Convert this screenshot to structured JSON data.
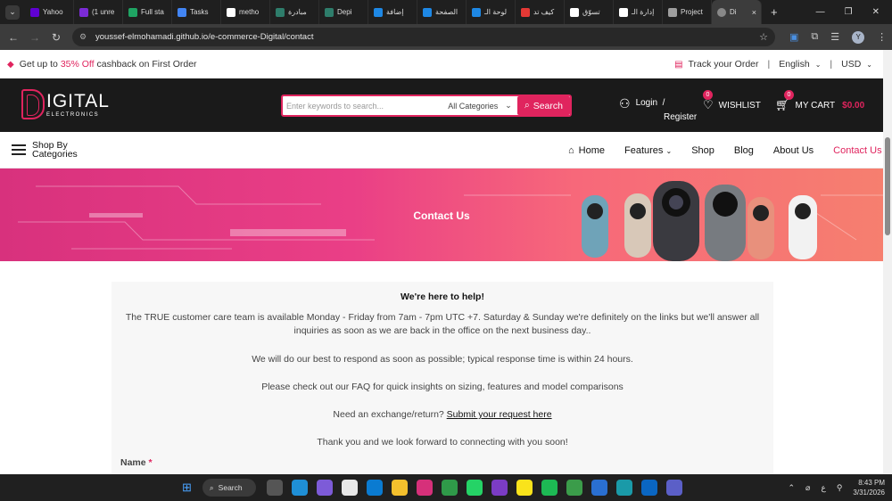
{
  "browser": {
    "tabs": [
      {
        "label": "Yahoo",
        "color": "#6001d2"
      },
      {
        "label": "(1 unre",
        "color": "#7b2bd6"
      },
      {
        "label": "Full sta",
        "color": "#1fa463"
      },
      {
        "label": "Tasks",
        "color": "#4285f4"
      },
      {
        "label": "metho",
        "color": "#ffffff"
      },
      {
        "label": "مبادرة",
        "color": "#2e7d6b"
      },
      {
        "label": "Depi",
        "color": "#2e7d6b"
      },
      {
        "label": "إضافة",
        "color": "#1e88e5"
      },
      {
        "label": "الصفحة",
        "color": "#1e88e5"
      },
      {
        "label": "لوحة الـ",
        "color": "#1e88e5"
      },
      {
        "label": "كيف تد",
        "color": "#e53935"
      },
      {
        "label": "تسوّق",
        "color": "#ffffff"
      },
      {
        "label": "إدارة الـ",
        "color": "#ffffff"
      },
      {
        "label": "Project",
        "color": "#9e9e9e"
      }
    ],
    "active_tab": {
      "label": "Di",
      "close": "×"
    },
    "new_tab": "+",
    "url": "youssef-elmohamadi.github.io/e-commerce-Digital/contact",
    "profile_initial": "Y"
  },
  "promo": {
    "prefix": "Get up to",
    "highlight": "35% Off",
    "suffix": "cashback on First Order",
    "track_order": "Track your Order",
    "language": "English",
    "currency": "USD"
  },
  "header": {
    "logo_main": "IGITAL",
    "logo_sub": "ELECTRONICS",
    "search_placeholder": "Enter keywords to search...",
    "category": "All Categories",
    "search_button": "Search",
    "login": "Login",
    "slash": "/",
    "register": "Register",
    "wishlist": "WISHLIST",
    "wishlist_count": "0",
    "cart_label": "MY CART",
    "cart_count": "0",
    "cart_total": "$0.00",
    "accent": "#e0245e"
  },
  "nav": {
    "shop_by": "Shop By",
    "categories": "Categories",
    "links": {
      "home": "Home",
      "features": "Features",
      "shop": "Shop",
      "blog": "Blog",
      "about": "About Us",
      "contact": "Contact Us"
    }
  },
  "banner": {
    "title": "Contact Us"
  },
  "content": {
    "heading": "We're here to help!",
    "para1": "The TRUE customer care team is available Monday - Friday from 7am - 7pm UTC +7. Saturday & Sunday we're definitely on the links but we'll answer all inquiries as soon as we are back in the office on the next business day..",
    "para2": "We will do our best to respond as soon as possible; typical response time is within 24 hours.",
    "para3": "Please check out our FAQ for quick insights on sizing, features and model comparisons",
    "exchange_prefix": "Need an exchange/return?",
    "exchange_link": "Submit your request here",
    "thanks": "Thank you and we look forward to connecting with you soon!",
    "name_label": "Name",
    "required_mark": "*"
  },
  "taskbar": {
    "search": "Search",
    "time": "8:43 PM",
    "date": "3/31/2026",
    "lang": "ع"
  }
}
